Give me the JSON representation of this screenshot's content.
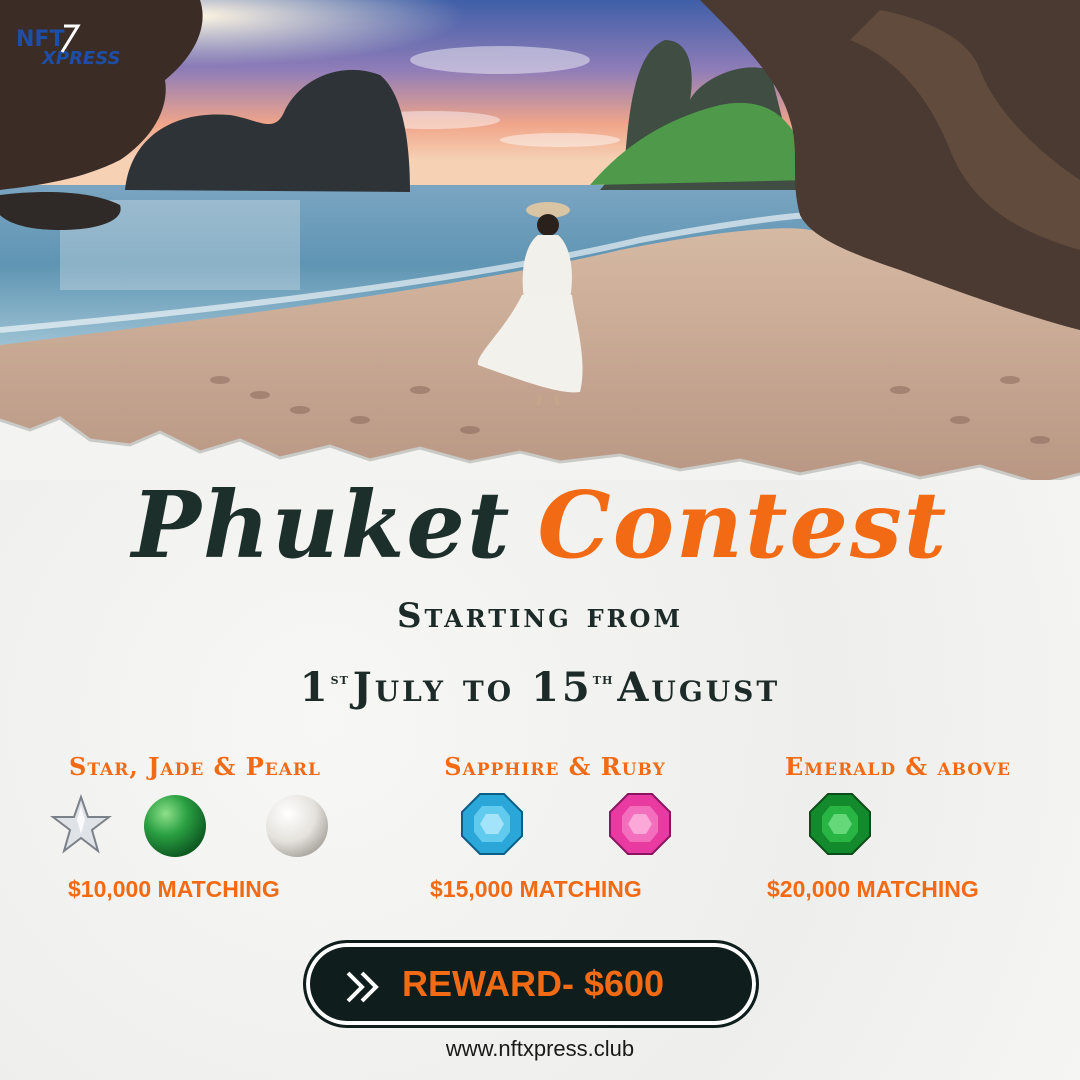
{
  "brand": {
    "logo_text_top": "NFT",
    "logo_text_bottom": "XPRESS"
  },
  "title": {
    "word1": "Phuket",
    "word2": "Contest"
  },
  "subtitle": "Starting from",
  "dates": {
    "start_num": "1",
    "start_sup": "st",
    "start_month": "July to",
    "end_num": "15",
    "end_sup": "th",
    "end_month": "August"
  },
  "tiers": [
    {
      "title": "Star, Jade & Pearl",
      "amount": "$10,000 MATCHING",
      "gems": [
        "star-diamond-icon",
        "jade-orb-icon",
        "pearl-icon"
      ]
    },
    {
      "title": "Sapphire & Ruby",
      "amount": "$15,000 MATCHING",
      "gems": [
        "sapphire-gem-icon",
        "ruby-gem-icon"
      ]
    },
    {
      "title": "Emerald & above",
      "amount": "$20,000 MATCHING",
      "gems": [
        "emerald-gem-icon"
      ]
    }
  ],
  "reward": {
    "label": "REWARD- $600",
    "icon": "double-chevron-right-icon"
  },
  "website": "www.nftxpress.club",
  "colors": {
    "accent": "#f26b14",
    "dark": "#1c2f2b",
    "paper": "#f3f3f1"
  }
}
